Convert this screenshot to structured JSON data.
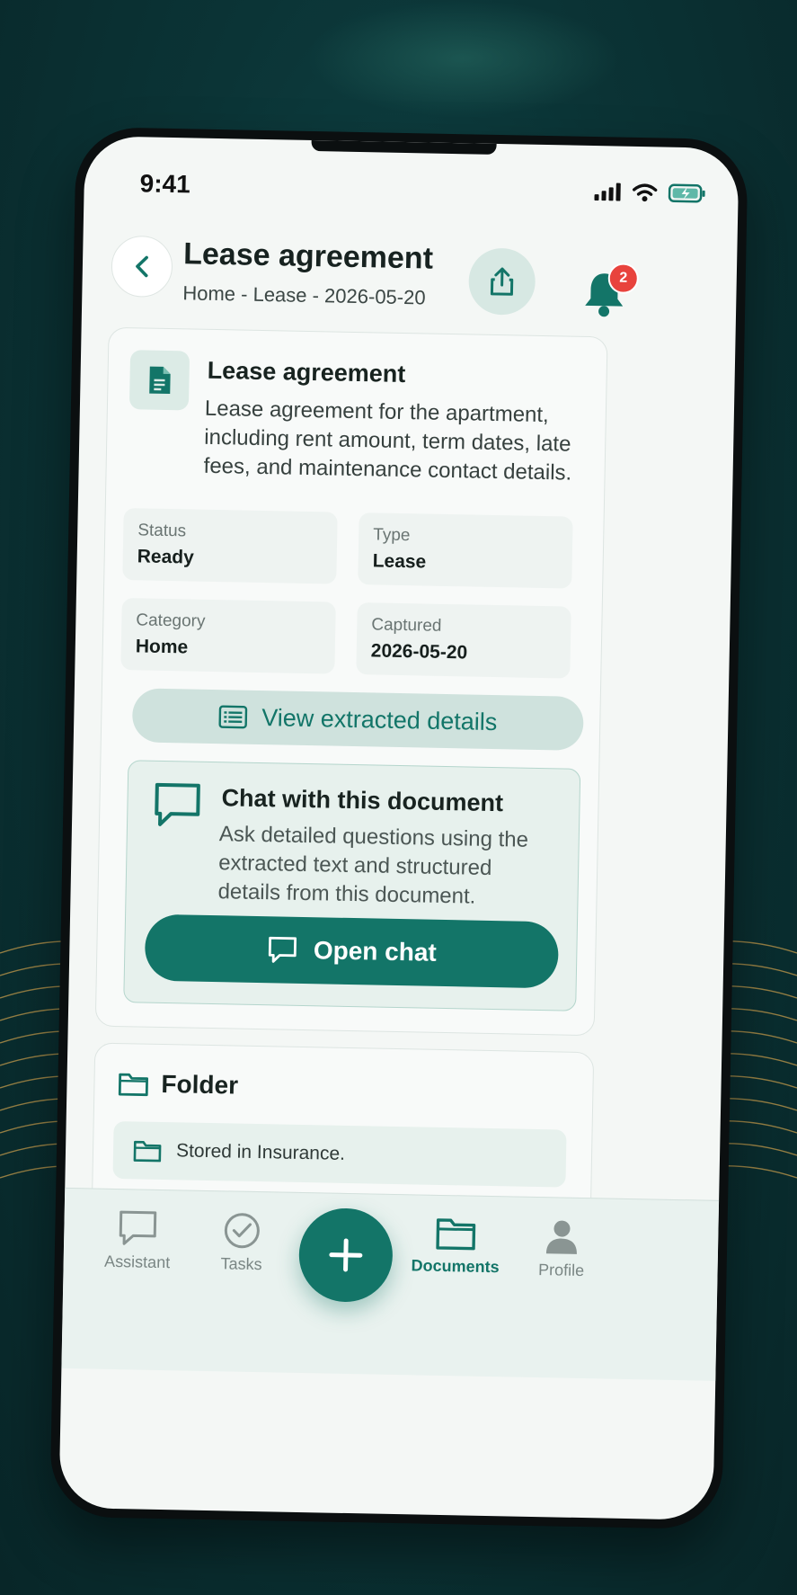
{
  "status_bar": {
    "time": "9:41"
  },
  "header": {
    "title": "Lease agreement",
    "breadcrumb": "Home - Lease - 2026-05-20",
    "notification_count": "2"
  },
  "document": {
    "title": "Lease agreement",
    "description": "Lease agreement for the apartment, including rent amount, term dates, late fees, and maintenance contact details.",
    "fields": [
      {
        "label": "Status",
        "value": "Ready"
      },
      {
        "label": "Type",
        "value": "Lease"
      },
      {
        "label": "Category",
        "value": "Home"
      },
      {
        "label": "Captured",
        "value": "2026-05-20"
      }
    ],
    "view_details_label": "View extracted details"
  },
  "chat": {
    "title": "Chat with this document",
    "description": "Ask detailed questions using the extracted text and structured details from this document.",
    "button_label": "Open chat"
  },
  "folder": {
    "title": "Folder",
    "stored_text": "Stored in Insurance."
  },
  "bottom_nav": {
    "items": [
      {
        "label": "Assistant",
        "icon": "chat-bubble-icon",
        "active": false
      },
      {
        "label": "Tasks",
        "icon": "check-circle-icon",
        "active": false
      },
      {
        "label": "Documents",
        "icon": "folder-icon",
        "active": true
      },
      {
        "label": "Profile",
        "icon": "person-icon",
        "active": false
      }
    ],
    "fab_icon": "plus-icon"
  },
  "colors": {
    "accent": "#137568",
    "accent_light": "#cfe2dd",
    "background": "#0b3436",
    "screen": "#f4f7f5",
    "badge": "#e8433d"
  }
}
